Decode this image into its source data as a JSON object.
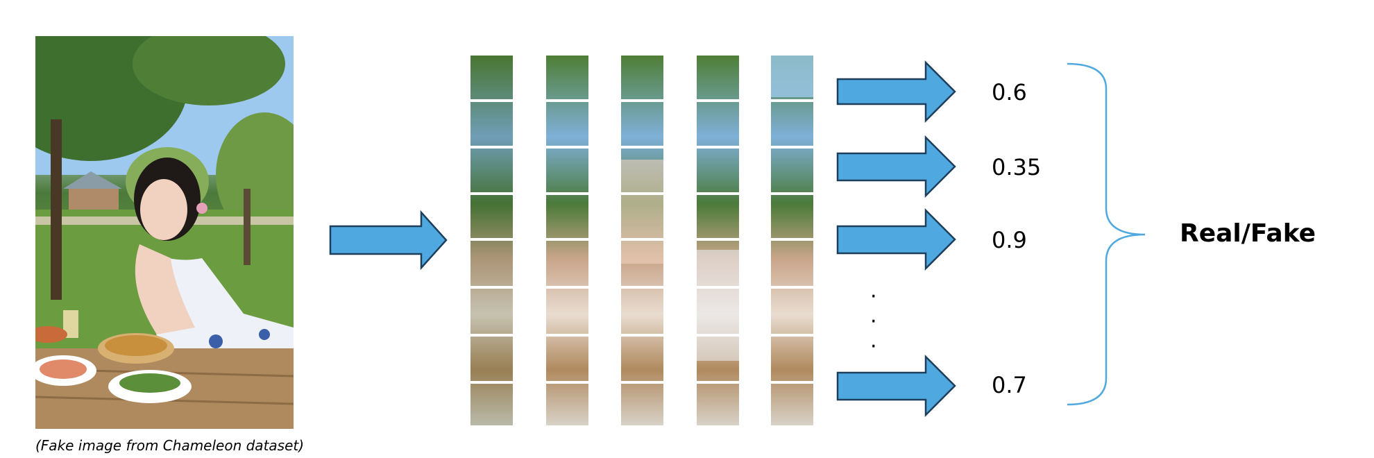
{
  "caption": "(Fake image from Chameleon dataset)",
  "scores": [
    "0.6",
    "0.35",
    "0.9",
    "0.7"
  ],
  "ellipsis": [
    "·",
    "·",
    "·"
  ],
  "result": "Real/Fake",
  "patch_grid": {
    "columns": 5,
    "rows": 8
  },
  "colors": {
    "arrow_fill": "#4fa9e0",
    "arrow_stroke": "#1d3f5c",
    "brace": "#4fa9e0"
  }
}
